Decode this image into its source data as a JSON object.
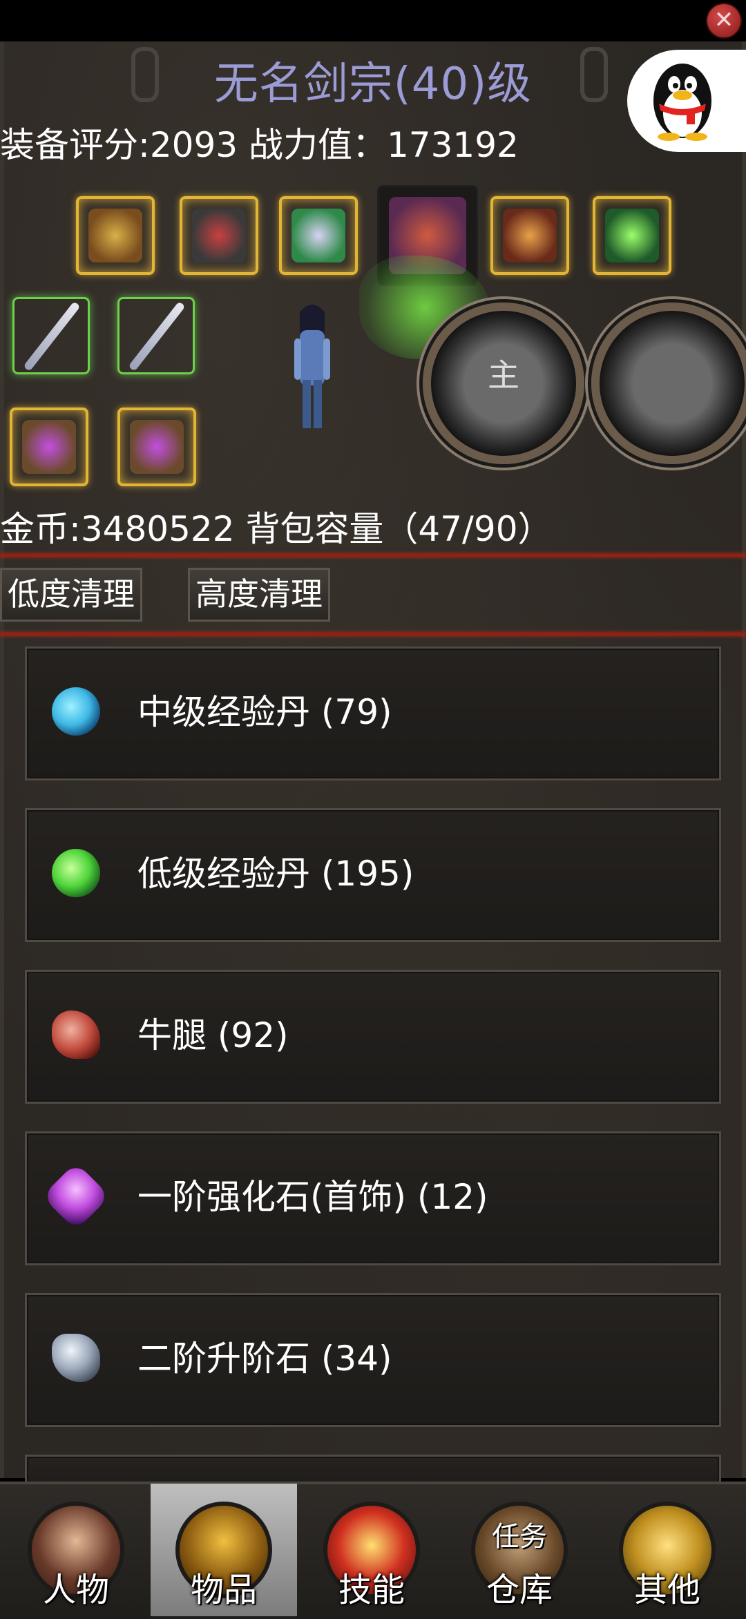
{
  "window": {
    "title": "无名剑宗(40)级"
  },
  "stats": {
    "equip_score_text": "装备评分:2093",
    "power_text": "战力值：173192"
  },
  "inventory": {
    "gold_text": "金币:3480522",
    "capacity_text": "背包容量（47/90）"
  },
  "buttons": {
    "low_clean": "低度清理",
    "high_clean": "高度清理"
  },
  "tigers": {
    "main_label": "主"
  },
  "items": [
    {
      "name": "中级经验丹 (79)",
      "icon": "blue-orb-icon",
      "color": "#3fb9e6"
    },
    {
      "name": "低级经验丹 (195)",
      "icon": "green-orb-icon",
      "color": "#4fd43a"
    },
    {
      "name": "牛腿 (92)",
      "icon": "meat-leg-icon",
      "color": "#c0493b"
    },
    {
      "name": "一阶强化石(首饰) (12)",
      "icon": "purple-gem-icon",
      "color": "#c24fe0"
    },
    {
      "name": "二阶升阶石 (34)",
      "icon": "gray-stone-icon",
      "color": "#9aa6b8"
    }
  ],
  "tabs": [
    {
      "label": "人物",
      "icon": "character-portrait-icon"
    },
    {
      "label": "物品",
      "icon": "golden-helmet-icon"
    },
    {
      "label": "技能",
      "icon": "sword-burst-icon"
    },
    {
      "label": "任务 仓库",
      "top": "任务",
      "bottom": "仓库",
      "icon": "treasure-chest-icon"
    },
    {
      "label": "其他",
      "icon": "golden-cup-icon"
    }
  ],
  "colors": {
    "title": "#9b9bd6",
    "accent_red": "#9a1e10",
    "gold_frame": "#e2b634"
  }
}
